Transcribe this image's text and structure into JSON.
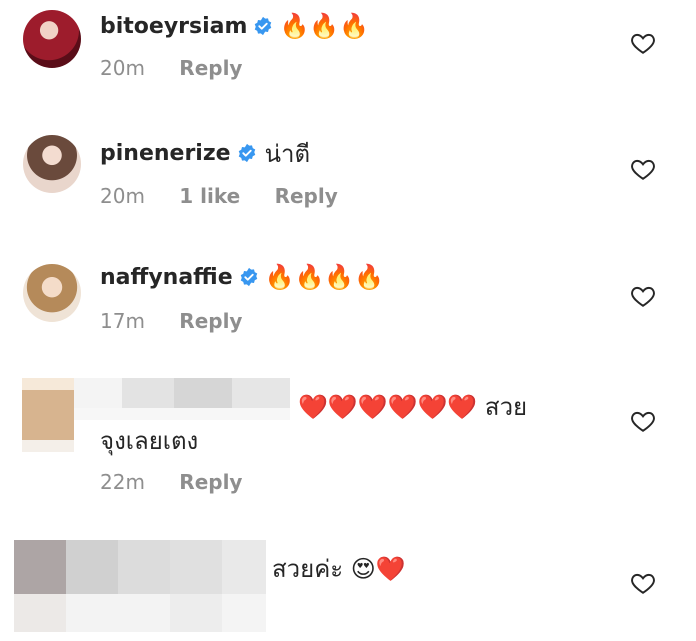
{
  "comments": [
    {
      "username": "bitoeyrsiam",
      "verified": true,
      "text": "",
      "emoji": "🔥🔥🔥",
      "time": "20m",
      "likes": "",
      "reply_label": "Reply"
    },
    {
      "username": "pinenerize",
      "verified": true,
      "text": "น่าตี",
      "emoji": "",
      "time": "20m",
      "likes": "1 like",
      "reply_label": "Reply"
    },
    {
      "username": "naffynaffie",
      "verified": true,
      "text": "",
      "emoji": "🔥🔥🔥🔥",
      "time": "17m",
      "likes": "",
      "reply_label": "Reply"
    },
    {
      "username": "",
      "verified": false,
      "text": "❤️❤️❤️❤️❤️❤️ สวย",
      "text_line2": "จุงเลยเตง",
      "time": "22m",
      "likes": "",
      "reply_label": "Reply"
    },
    {
      "username": "",
      "verified": false,
      "text": "สวยค่ะ 😍❤️",
      "time": "",
      "likes": "",
      "reply_label": ""
    }
  ],
  "colors": {
    "verified_blue": "#3897f0",
    "meta_gray": "#8e8e8e",
    "text_dark": "#262626"
  },
  "icons": {
    "like": "heart-outline-icon",
    "verified": "verified-badge-icon"
  }
}
